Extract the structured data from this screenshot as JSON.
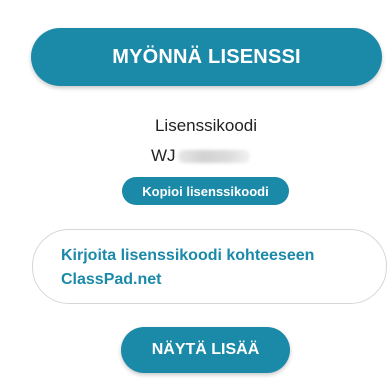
{
  "actions": {
    "grant_license_label": "MYÖNNÄ LISENSSI",
    "copy_code_label": "Kopioi lisenssikoodi",
    "show_more_label": "NÄYTÄ LISÄÄ"
  },
  "license": {
    "label": "Lisenssikoodi",
    "code_visible_prefix": "WJ"
  },
  "instruction": {
    "text": "Kirjoita lisenssikoodi kohteeseen ClassPad.net"
  },
  "colors": {
    "accent": "#1b89a8",
    "text": "#222222",
    "background": "#ffffff",
    "border": "#d7d7d7"
  }
}
